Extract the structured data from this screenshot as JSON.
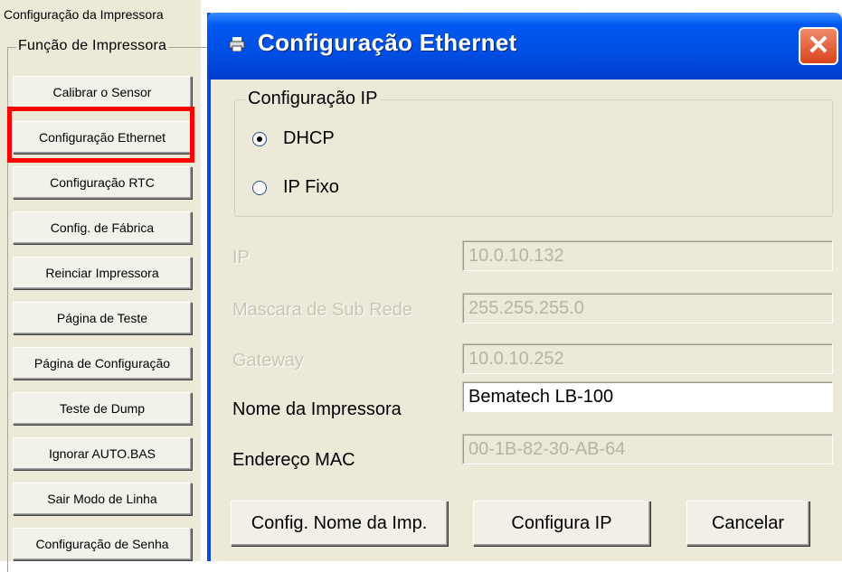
{
  "left_panel": {
    "title": "Configuração da Impressora",
    "group_label": "Função de Impressora",
    "buttons": [
      "Calibrar o Sensor",
      "Configuração Ethernet",
      "Configuração RTC",
      "Config. de Fábrica",
      "Reinciar Impressora",
      "Página de Teste",
      "Página de Configuração",
      "Teste de Dump",
      "Ignorar AUTO.BAS",
      "Sair Modo de Linha",
      "Configuração de Senha"
    ],
    "highlighted_button": "Configuração Ethernet",
    "highlight_color": "#ff0000"
  },
  "dialog": {
    "title": "Configuração Ethernet",
    "title_icon": "printer-icon",
    "close_symbol": "✕",
    "ip_group": {
      "label": "Configuração IP",
      "options": [
        "DHCP",
        "IP Fixo"
      ],
      "selected": "DHCP"
    },
    "fields": {
      "ip": {
        "label": "IP",
        "value": "10.0.10.132"
      },
      "subnet": {
        "label": "Mascara de Sub Rede",
        "value": "255.255.255.0"
      },
      "gateway": {
        "label": "Gateway",
        "value": "10.0.10.252"
      },
      "printer_name": {
        "label": "Nome da Impressora",
        "value": "Bematech LB-100"
      },
      "mac": {
        "label": "Endereço MAC",
        "value": "00-1B-82-30-AB-64"
      }
    },
    "buttons": {
      "config_name": "Config. Nome da Imp.",
      "config_ip": "Configura IP",
      "cancel": "Cancelar"
    }
  },
  "colors": {
    "window_bg": "#ece9d8",
    "titlebar_blue": "#0050e6",
    "close_red": "#d9441d"
  }
}
